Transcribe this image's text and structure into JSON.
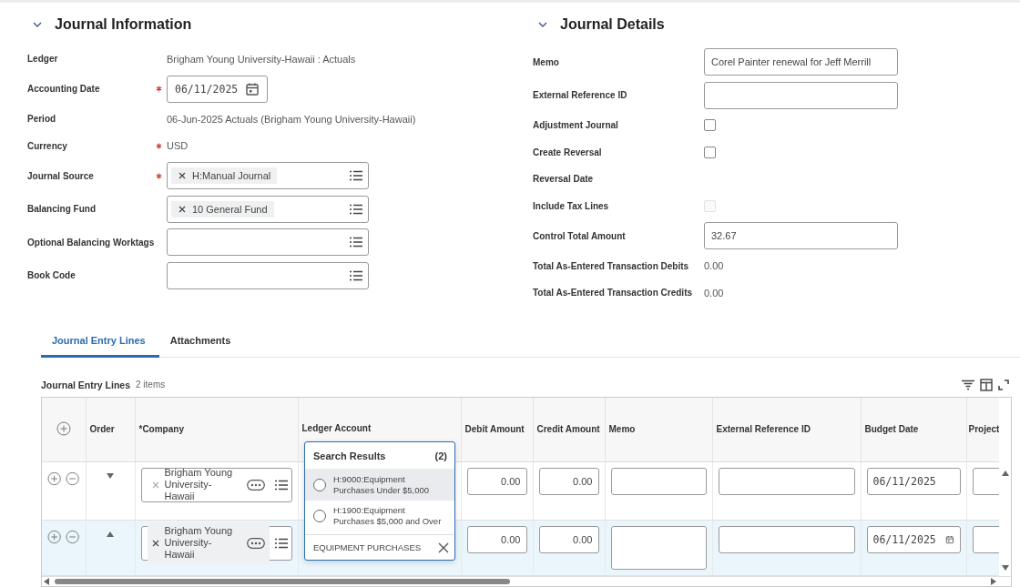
{
  "journal_information": {
    "title": "Journal Information",
    "expanded": true,
    "fields": [
      {
        "kind": "text",
        "label": "Ledger",
        "value": "Brigham Young University-Hawaii : Actuals",
        "required": false
      },
      {
        "kind": "date",
        "label": "Accounting Date",
        "value": "06/11/2025",
        "required": true
      },
      {
        "kind": "text",
        "label": "Period",
        "value": "06-Jun-2025 Actuals (Brigham Young University-Hawaii)",
        "required": false
      },
      {
        "kind": "text",
        "label": "Currency",
        "value": "USD",
        "required": true
      },
      {
        "kind": "prompt",
        "label": "Journal Source",
        "tags": [
          "H:Manual Journal"
        ],
        "required": true
      },
      {
        "kind": "prompt",
        "label": "Balancing Fund",
        "tags": [
          "10 General Fund"
        ],
        "required": false
      },
      {
        "kind": "prompt",
        "label": "Optional Balancing Worktags",
        "required": false
      },
      {
        "kind": "prompt",
        "label": "Book Code",
        "required": false
      }
    ]
  },
  "journal_details": {
    "title": "Journal Details",
    "expanded": true,
    "fields": [
      {
        "kind": "input",
        "label": "Memo",
        "value": "Corel Painter renewal for Jeff Merrill"
      },
      {
        "kind": "input",
        "label": "External Reference ID"
      },
      {
        "kind": "checkbox",
        "label": "Adjustment Journal",
        "checked": false,
        "disabled": false
      },
      {
        "kind": "checkbox",
        "label": "Create Reversal",
        "checked": false,
        "disabled": false
      },
      {
        "kind": "label",
        "label": "Reversal Date"
      },
      {
        "kind": "checkbox",
        "label": "Include Tax Lines",
        "checked": false,
        "disabled": true
      },
      {
        "kind": "input",
        "label": "Control Total Amount",
        "value": "32.67"
      },
      {
        "kind": "text",
        "label": "Total As-Entered Transaction Debits",
        "value": "0.00"
      },
      {
        "kind": "text",
        "label": "Total As-Entered Transaction Credits",
        "value": "0.00"
      }
    ]
  },
  "tabs": [
    {
      "label": "Journal Entry Lines",
      "selected": true
    },
    {
      "label": "Attachments",
      "selected": false
    }
  ],
  "grid": {
    "title": "Journal Entry Lines",
    "count": "2 items",
    "columns": [
      "Order",
      "*Company",
      "Ledger Account",
      "Debit Amount",
      "Credit Amount",
      "Memo",
      "External Reference ID",
      "Budget Date",
      "Project"
    ],
    "rows": [
      {
        "selected": false,
        "kind": "move_down",
        "company": "Brigham Young University-Hawaii",
        "debit": "0.00",
        "credit": "0.00",
        "budget_date": "06/11/2025"
      },
      {
        "selected": true,
        "kind": "move_up",
        "company": "Brigham Young University-Hawaii",
        "debit": "0.00",
        "credit": "0.00",
        "budget_date": "06/11/2025"
      }
    ]
  },
  "search_popup": {
    "title": "Search Results",
    "count": "(2)",
    "options": [
      {
        "label": "H:9000:Equipment Purchases Under $5,000",
        "selected": true
      },
      {
        "label": "H:1900:Equipment Purchases $5,000 and Over",
        "selected": false
      }
    ],
    "search_value": "EQUIPMENT PURCHASES"
  }
}
